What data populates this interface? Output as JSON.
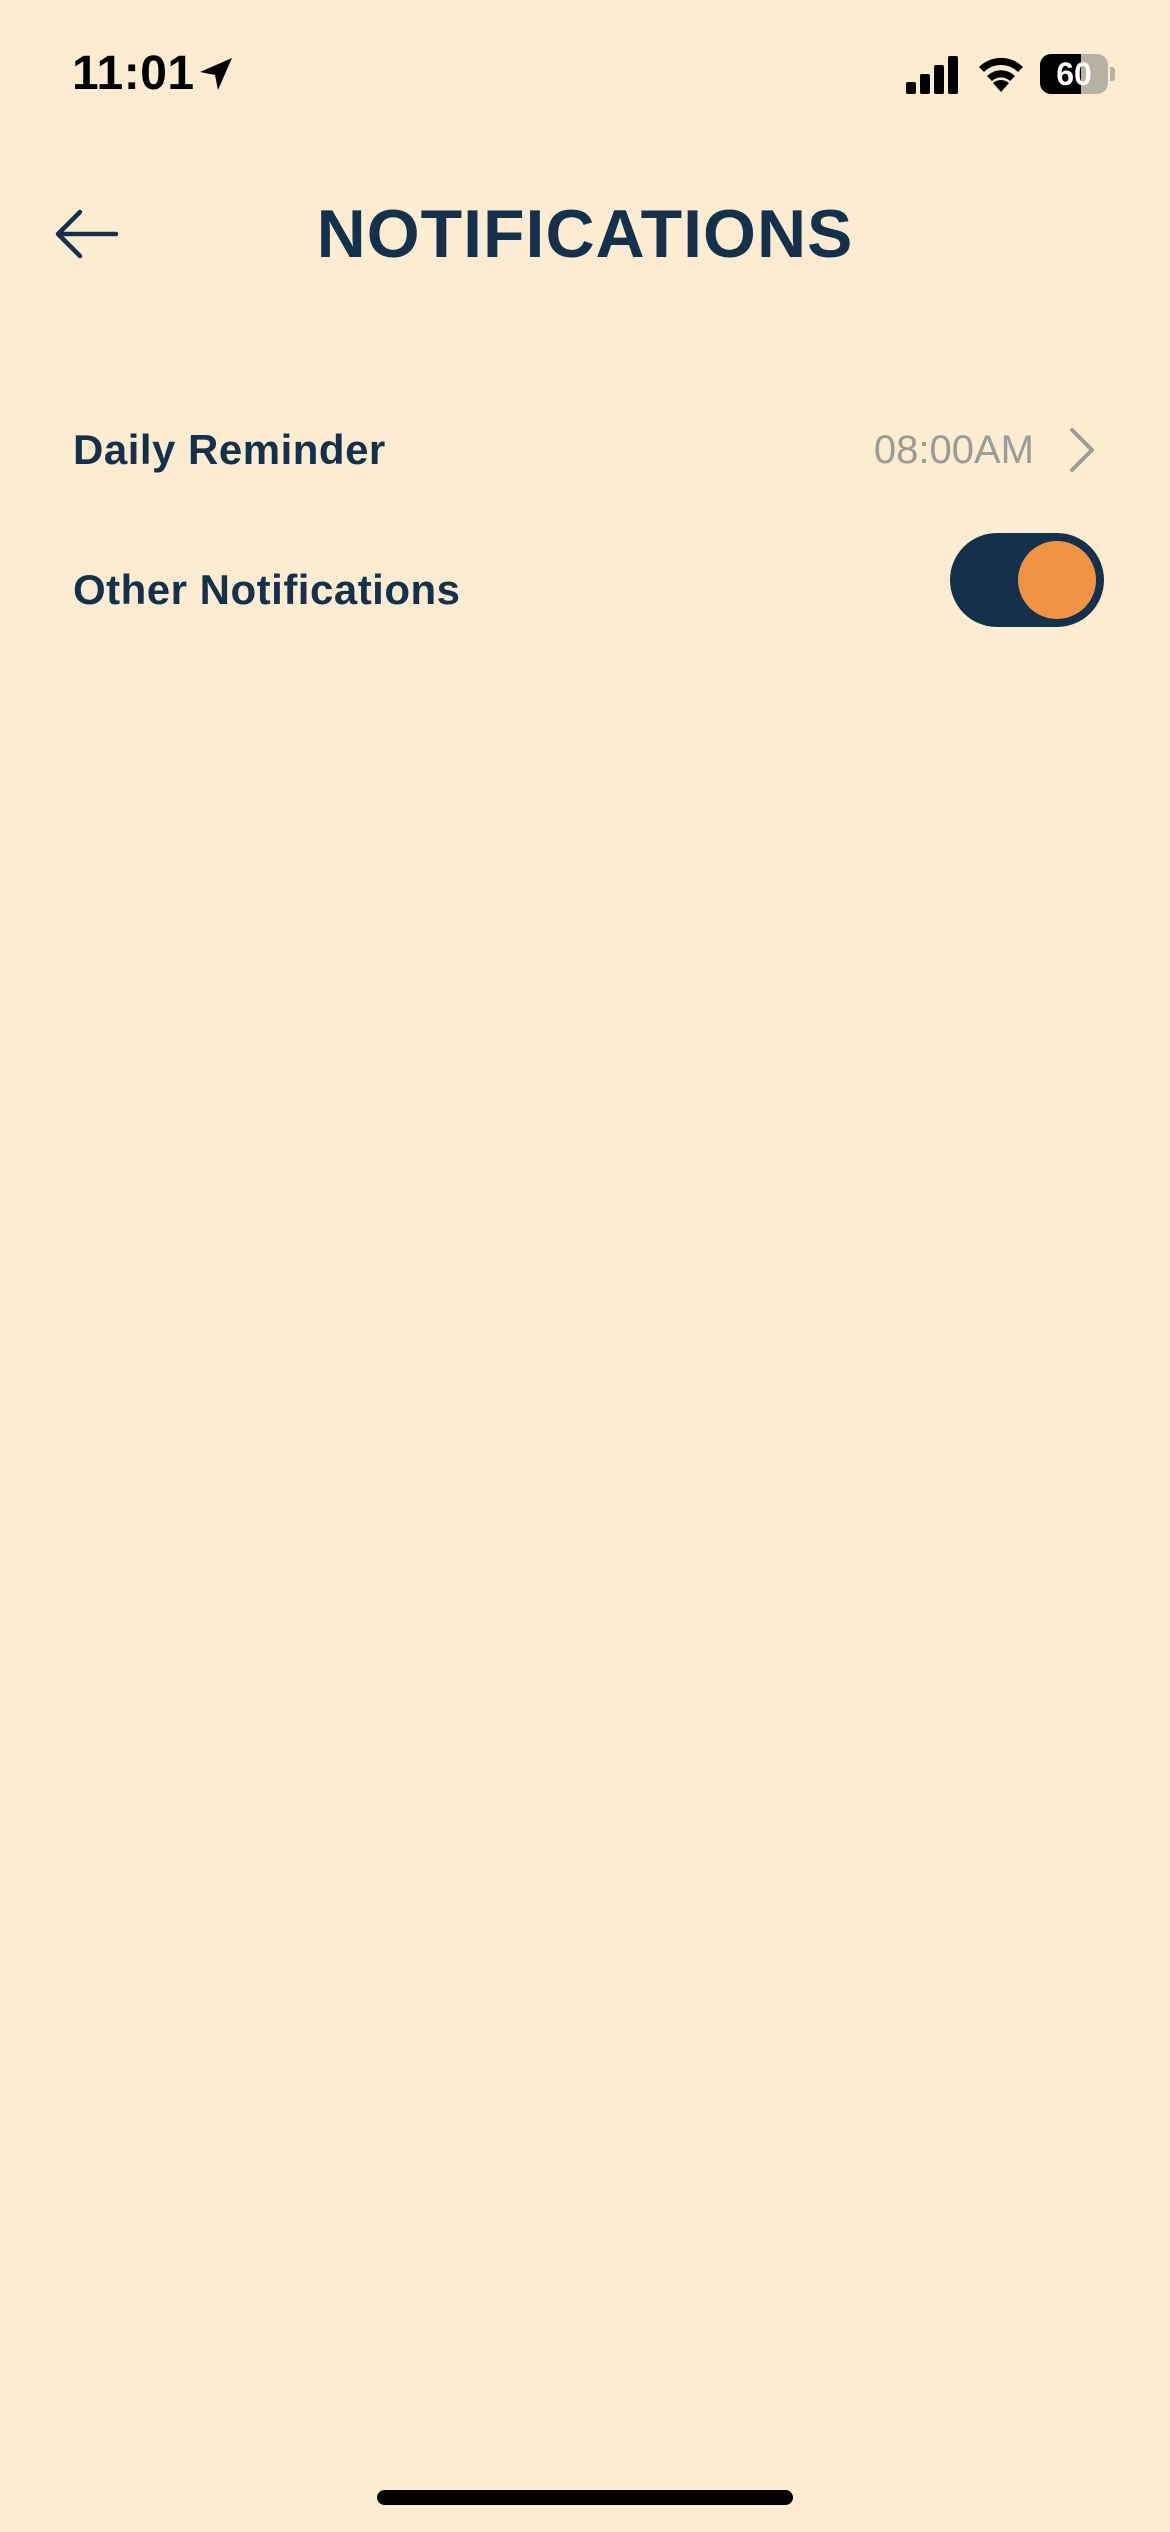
{
  "status_bar": {
    "time": "11:01",
    "battery_level": "60",
    "battery_fraction": 0.6,
    "icons": [
      "location-arrow-icon",
      "cellular-signal-icon",
      "wifi-icon",
      "battery-icon"
    ]
  },
  "header": {
    "title": "NOTIFICATIONS",
    "back_icon": "arrow-left-icon"
  },
  "settings": {
    "daily_reminder": {
      "label": "Daily Reminder",
      "value": "08:00AM",
      "icon": "chevron-right-icon"
    },
    "other_notifications": {
      "label": "Other Notifications",
      "enabled": true
    }
  },
  "colors": {
    "background": "#FCEDD2",
    "primary_text": "#14304A",
    "secondary_text": "#9C9B96",
    "toggle_track": "#14304A",
    "toggle_knob": "#EF9344"
  }
}
